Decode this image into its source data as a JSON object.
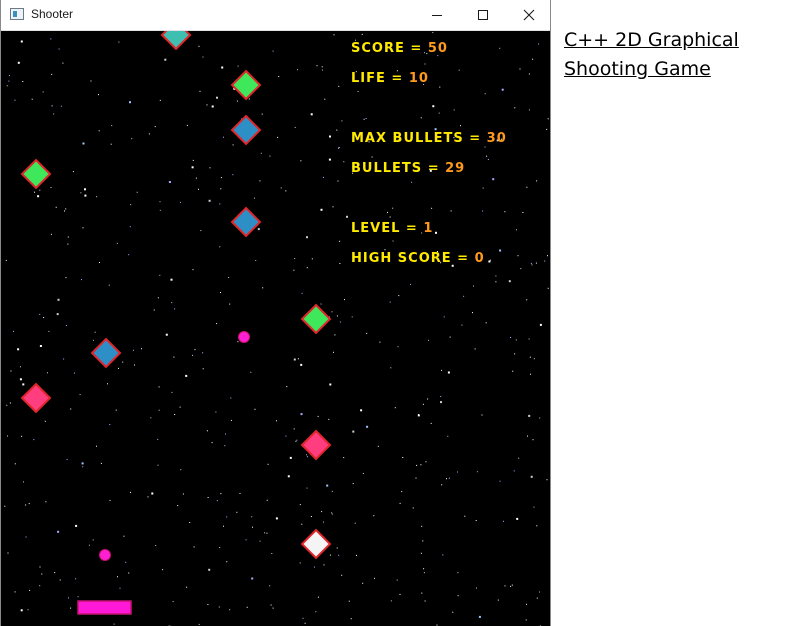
{
  "window": {
    "title": "Shooter"
  },
  "hud": {
    "score_label": "SCORE",
    "score_value": "50",
    "life_label": "LIFE",
    "life_value": "10",
    "max_bullets_label": "MAX BULLETS",
    "max_bullets_value": "30",
    "bullets_label": "BULLETS",
    "bullets_value": "29",
    "level_label": "LEVEL",
    "level_value": "1",
    "high_score_label": "HIGH SCORE",
    "high_score_value": "0",
    "equals": "="
  },
  "caption": {
    "line1": "C++ 2D Graphical",
    "line2": "Shooting Game"
  },
  "colors": {
    "background": "#000000",
    "hud_label": "#ffea00",
    "hud_value": "#ff9a1e",
    "enemy_border": "#e0262a",
    "enemy_teal": "#3fbfb0",
    "enemy_green": "#3ee85a",
    "enemy_blue": "#2e8fc7",
    "enemy_pink": "#ff3d7f",
    "enemy_white": "#f4f4f4",
    "bullet": "#ff1fd4",
    "player": "#ff18d8"
  },
  "enemies": [
    {
      "kind": "teal"
    },
    {
      "kind": "green"
    },
    {
      "kind": "blue"
    },
    {
      "kind": "green"
    },
    {
      "kind": "blue"
    },
    {
      "kind": "green"
    },
    {
      "kind": "blue"
    },
    {
      "kind": "pink"
    },
    {
      "kind": "pink"
    },
    {
      "kind": "white"
    }
  ],
  "bullets": [
    {
      "kind": "bullet"
    },
    {
      "kind": "bullet"
    }
  ],
  "player": {
    "kind": "player-ship"
  }
}
